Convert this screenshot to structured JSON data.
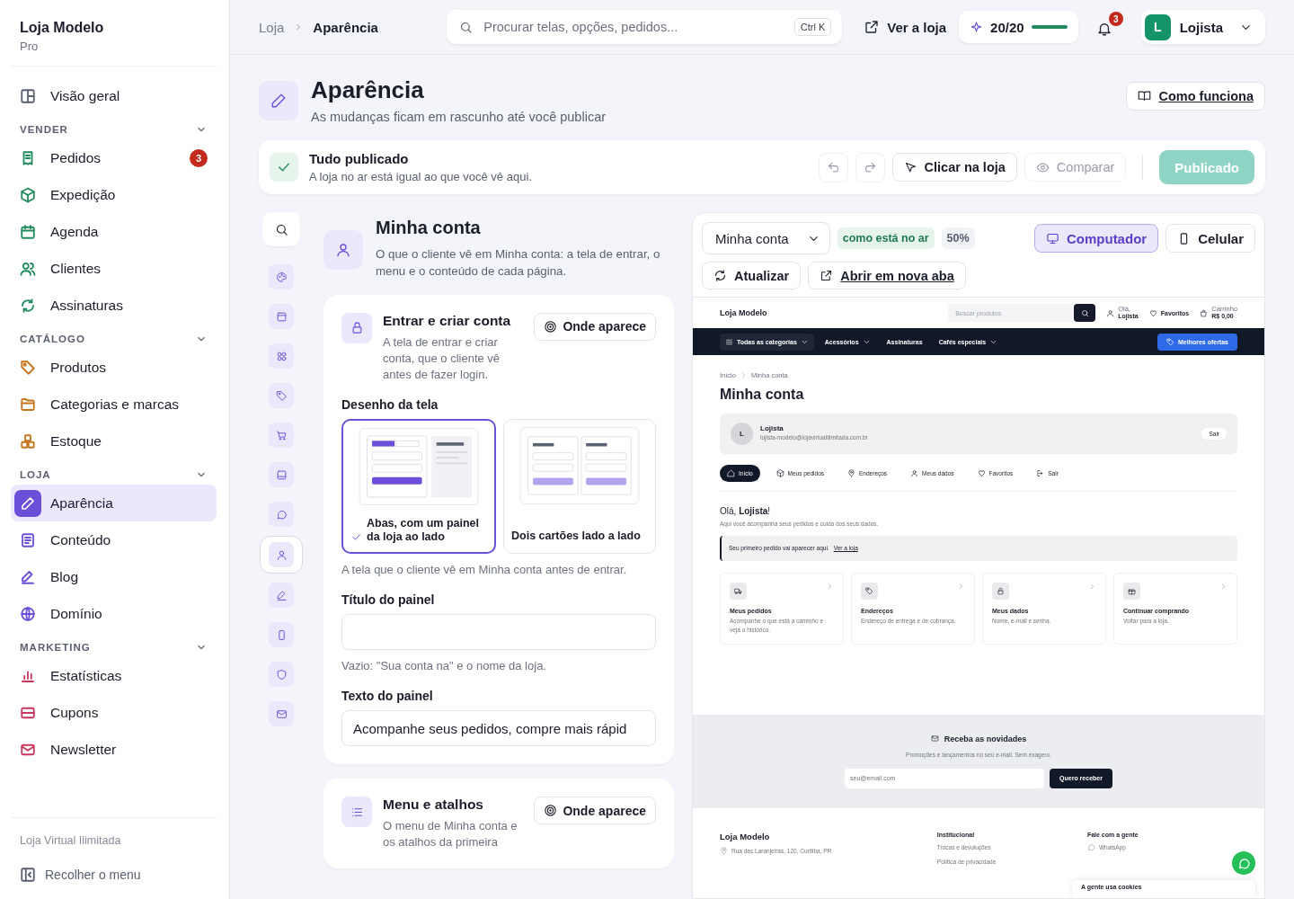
{
  "sidebar": {
    "brand": "Loja Modelo",
    "plan": "Pro",
    "top_item": {
      "label": "Visão geral",
      "selected": false
    },
    "groups": [
      {
        "title": "VENDER",
        "color": "#1f8a5b",
        "expanded": true,
        "items": [
          {
            "label": "Pedidos",
            "selected": false,
            "badge": "3"
          },
          {
            "label": "Expedição",
            "selected": false
          },
          {
            "label": "Agenda",
            "selected": false
          },
          {
            "label": "Clientes",
            "selected": false
          },
          {
            "label": "Assinaturas",
            "selected": false
          }
        ]
      },
      {
        "title": "CATÁLOGO",
        "color": "#c8731a",
        "expanded": true,
        "items": [
          {
            "label": "Produtos",
            "selected": false
          },
          {
            "label": "Categorias e marcas",
            "selected": false
          },
          {
            "label": "Estoque",
            "selected": false
          }
        ]
      },
      {
        "title": "LOJA",
        "color": "#6b4fd8",
        "expanded": true,
        "items": [
          {
            "label": "Aparência",
            "selected": true
          },
          {
            "label": "Conteúdo",
            "selected": false
          },
          {
            "label": "Blog",
            "selected": false
          },
          {
            "label": "Domínio",
            "selected": false
          }
        ]
      },
      {
        "title": "MARKETING",
        "color": "#c8365e",
        "expanded": true,
        "items": [
          {
            "label": "Estatísticas",
            "selected": false
          },
          {
            "label": "Cupons",
            "selected": false
          },
          {
            "label": "Newsletter",
            "selected": false
          }
        ]
      }
    ],
    "footer": "Loja Virtual Ilimitada",
    "collapse": "Recolher o menu"
  },
  "topbar": {
    "breadcrumb": [
      "Loja",
      "Aparência"
    ],
    "search": {
      "placeholder": "Procurar telas, opções, pedidos...",
      "shortcut": "Ctrl K"
    },
    "view_store": "Ver a loja",
    "progress": {
      "label": "20/20",
      "level": 1
    },
    "notifications": "3",
    "user": {
      "initial": "L",
      "name": "Lojista"
    }
  },
  "page": {
    "title": "Aparência",
    "subtitle": "As mudanças ficam em rascunho até você publicar",
    "help": "Como funciona"
  },
  "status": {
    "title": "Tudo publicado",
    "text": "A loja no ar está igual ao que você vê aqui.",
    "click": "Clicar na loja",
    "compare": "Comparar",
    "publish": {
      "label": "Publicado",
      "disabled": true
    }
  },
  "rail": [
    {
      "selected": false
    },
    {
      "selected": false
    },
    {
      "selected": false
    },
    {
      "selected": false
    },
    {
      "selected": false
    },
    {
      "selected": false
    },
    {
      "selected": false
    },
    {
      "selected": true
    },
    {
      "selected": false
    },
    {
      "selected": false
    },
    {
      "selected": false
    },
    {
      "selected": false
    }
  ],
  "section": {
    "title": "Minha conta",
    "text": "O que o cliente vê em Minha conta: a tela de entrar, o menu e o conteúdo de cada página."
  },
  "cards": [
    {
      "title": "Entrar e criar conta",
      "text": "A tela de entrar e criar conta, que o cliente vê antes de fazer login.",
      "where": "Onde aparece",
      "design_label": "Desenho da tela",
      "options": [
        {
          "label": "Abas, com um painel da loja ao lado",
          "kind": "split",
          "selected": true
        },
        {
          "label": "Dois cartões lado a lado",
          "kind": "cards",
          "selected": false
        }
      ],
      "design_hint": "A tela que o cliente vê em Minha conta antes de entrar.",
      "fields": [
        {
          "label": "Título do painel",
          "hint": "Vazio: \"Sua conta na\" e o nome da loja."
        },
        {
          "label": "Texto do painel",
          "value": "Acompanhe seus pedidos, compre mais rápid"
        }
      ]
    },
    {
      "title": "Menu e atalhos",
      "text": "O menu de Minha conta e os atalhos da primeira",
      "where": "Onde aparece"
    }
  ],
  "preview": {
    "page_select": "Minha conta",
    "status": "como está no ar",
    "zoom": "50%",
    "devices": [
      {
        "label": "Computador",
        "selected": true
      },
      {
        "label": "Celular",
        "selected": false
      }
    ],
    "refresh": "Atualizar",
    "open_tab": "Abrir em nova aba",
    "store": {
      "logo": "Loja Modelo",
      "search_placeholder": "Buscar produtos",
      "greeting": "Olá,",
      "user": "Lojista",
      "favorites": "Favoritos",
      "cart_label": "Carrinho",
      "cart_total": "R$ 0,00",
      "nav": [
        {
          "label": "Todas as categorias",
          "kind": "menu"
        },
        {
          "label": "Acessórios",
          "kind": "dropdown"
        },
        {
          "label": "Assinaturas",
          "kind": "link"
        },
        {
          "label": "Cafés especiais",
          "kind": "dropdown"
        }
      ],
      "deals": "Melhores ofertas",
      "breadcrumb": [
        "Início",
        "Minha conta"
      ],
      "title": "Minha conta",
      "account": {
        "initial": "L",
        "name": "Lojista",
        "email": "lojista-modelo@lojavirtualilimitada.com.br",
        "logout": "Sair"
      },
      "tabs": [
        {
          "label": "Início",
          "selected": true
        },
        {
          "label": "Meus pedidos",
          "selected": false
        },
        {
          "label": "Endereços",
          "selected": false
        },
        {
          "label": "Meus dados",
          "selected": false
        },
        {
          "label": "Favoritos",
          "selected": false
        },
        {
          "label": "Sair",
          "selected": false
        }
      ],
      "hello": "Olá, **Lojista**!",
      "intro": "Aqui você acompanha seus pedidos e cuida dos seus dados.",
      "notice": {
        "text": "Seu primeiro pedido vai aparecer aqui.",
        "link": "Ver a loja"
      },
      "shortcuts": [
        {
          "title": "Meus pedidos",
          "text": "Acompanhe o que está a caminho e veja o histórico."
        },
        {
          "title": "Endereços",
          "text": "Endereço de entrega e de cobrança."
        },
        {
          "title": "Meus dados",
          "text": "Nome, e-mail e senha."
        },
        {
          "title": "Continuar comprando",
          "text": "Voltar para a loja."
        }
      ],
      "newsletter": {
        "title": "Receba as novidades",
        "text": "Promoções e lançamentos no seu e-mail. Sem exagero.",
        "placeholder": "seu@email.com",
        "button": "Quero receber"
      },
      "footer": {
        "brand": "Loja Modelo",
        "address": "Rua das Laranjeiras, 120, Curitiba, PR",
        "columns": [
          {
            "title": "Institucional",
            "links": [
              "Trocas e devoluções",
              "Política de privacidade"
            ]
          },
          {
            "title": "Fale com a gente",
            "links": [
              "WhatsApp"
            ]
          }
        ]
      },
      "cookie": "A gente usa cookies"
    }
  }
}
